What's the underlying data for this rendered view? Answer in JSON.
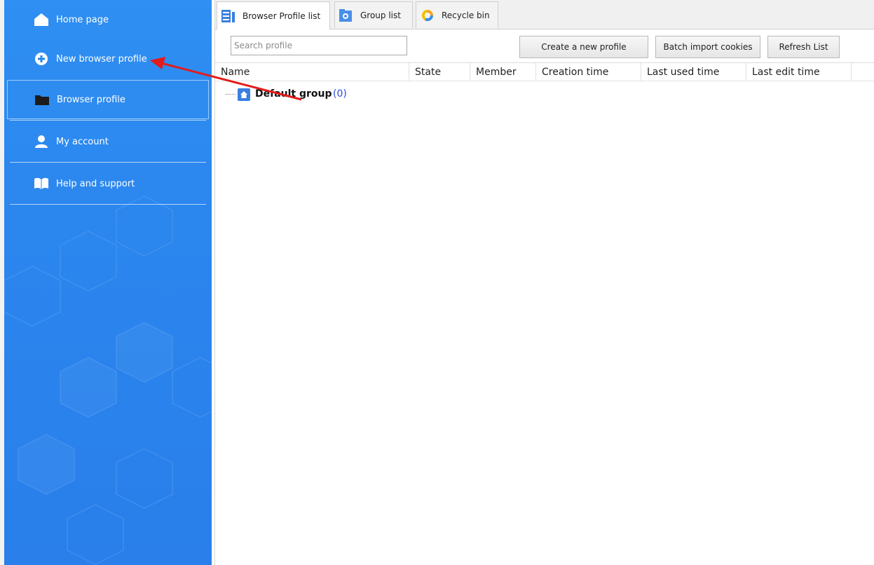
{
  "sidebar": {
    "items": [
      {
        "label": "Home page",
        "icon": "home-icon"
      },
      {
        "label": "New browser profile",
        "icon": "plus-circle-icon"
      },
      {
        "label": "Browser profile",
        "icon": "folder-icon",
        "active": true
      },
      {
        "label": "My account",
        "icon": "user-icon"
      },
      {
        "label": "Help and support",
        "icon": "book-icon"
      }
    ]
  },
  "tabs": [
    {
      "label": "Browser Profile list",
      "icon": "list-icon",
      "active": true
    },
    {
      "label": "Group list",
      "icon": "group-icon"
    },
    {
      "label": "Recycle bin",
      "icon": "recycle-icon"
    }
  ],
  "toolbar": {
    "search_placeholder": "Search profile",
    "create_label": "Create a new profile",
    "batch_import_label": "Batch import cookies",
    "refresh_label": "Refresh List"
  },
  "table": {
    "columns": [
      "Name",
      "State",
      "Member",
      "Creation time",
      "Last used time",
      "Last edit time"
    ]
  },
  "tree": {
    "group_name": "Default group",
    "group_count": "(0)"
  },
  "colors": {
    "sidebar_blue": "#2b86ee",
    "annotation_arrow": "#e41b1b",
    "count_blue": "#2b4dd6"
  }
}
